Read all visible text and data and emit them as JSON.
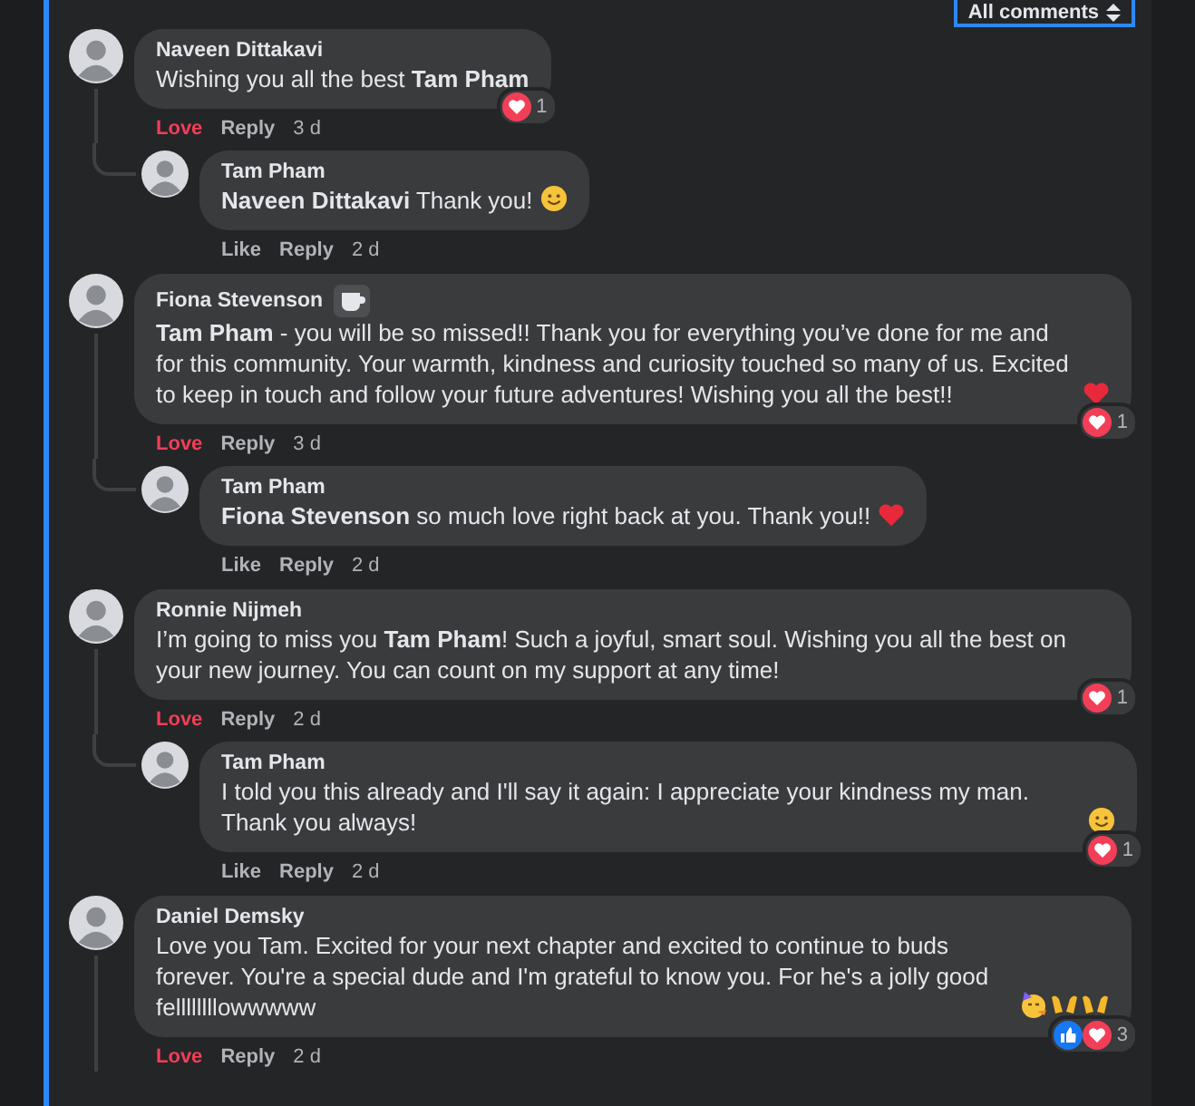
{
  "filter": {
    "label": "All comments"
  },
  "comments": [
    {
      "author": "Naveen Dittakavi",
      "text": "Wishing you all the best **Tam Pham**",
      "action": {
        "label": "Love",
        "reacted": true
      },
      "reply_label": "Reply",
      "time": "3 d",
      "reactions": {
        "icons": [
          {
            "kind": "love"
          }
        ],
        "count": "1"
      },
      "thread_line": true,
      "replies": [
        {
          "author": "Tam Pham",
          "text": "**Naveen Dittakavi** Thank you!",
          "emojis": [
            {
              "kind": "smile"
            }
          ],
          "action": {
            "label": "Like",
            "reacted": false
          },
          "reply_label": "Reply",
          "time": "2 d"
        }
      ]
    },
    {
      "author": "Fiona Stevenson",
      "badge": true,
      "text": "**Tam Pham** - you will be so missed!! Thank you for everything you’ve done for me and for this community. Your warmth, kindness and curiosity touched so many of us. Excited to keep in touch and follow your future adventures! Wishing you all the best!!",
      "emojis": [
        {
          "kind": "heart"
        }
      ],
      "action": {
        "label": "Love",
        "reacted": true
      },
      "reply_label": "Reply",
      "time": "3 d",
      "reactions": {
        "icons": [
          {
            "kind": "love"
          }
        ],
        "count": "1"
      },
      "thread_line": true,
      "replies": [
        {
          "author": "Tam Pham",
          "text": "**Fiona Stevenson** so much love right back at you. Thank you!!",
          "emojis": [
            {
              "kind": "heart"
            }
          ],
          "action": {
            "label": "Like",
            "reacted": false
          },
          "reply_label": "Reply",
          "time": "2 d"
        }
      ]
    },
    {
      "author": "Ronnie Nijmeh",
      "text": "I’m going to miss you **Tam Pham**! Such a joyful, smart soul. Wishing you all the best on your new journey. You can count on my support at any time!",
      "action": {
        "label": "Love",
        "reacted": true
      },
      "reply_label": "Reply",
      "time": "2 d",
      "reactions": {
        "icons": [
          {
            "kind": "love"
          }
        ],
        "count": "1"
      },
      "thread_line": true,
      "replies": [
        {
          "author": "Tam Pham",
          "text": "I told you this already and I'll say it again: I appreciate your kindness my man. Thank you always!",
          "emojis": [
            {
              "kind": "smile"
            }
          ],
          "action": {
            "label": "Like",
            "reacted": false
          },
          "reply_label": "Reply",
          "time": "2 d",
          "reactions": {
            "icons": [
              {
                "kind": "love"
              }
            ],
            "count": "1"
          }
        }
      ]
    },
    {
      "author": "Daniel Demsky",
      "text": "Love you Tam. Excited for your next chapter and excited to continue to buds forever. You're a special dude and I'm grateful to know you. For he's a jolly good fellllllllowwwww",
      "emojis": [
        {
          "kind": "party"
        },
        {
          "kind": "hands"
        },
        {
          "kind": "hands"
        }
      ],
      "action": {
        "label": "Love",
        "reacted": true
      },
      "reply_label": "Reply",
      "time": "2 d",
      "reactions": {
        "icons": [
          {
            "kind": "like"
          },
          {
            "kind": "love"
          }
        ],
        "count": "3"
      },
      "thread_line": true
    }
  ]
}
